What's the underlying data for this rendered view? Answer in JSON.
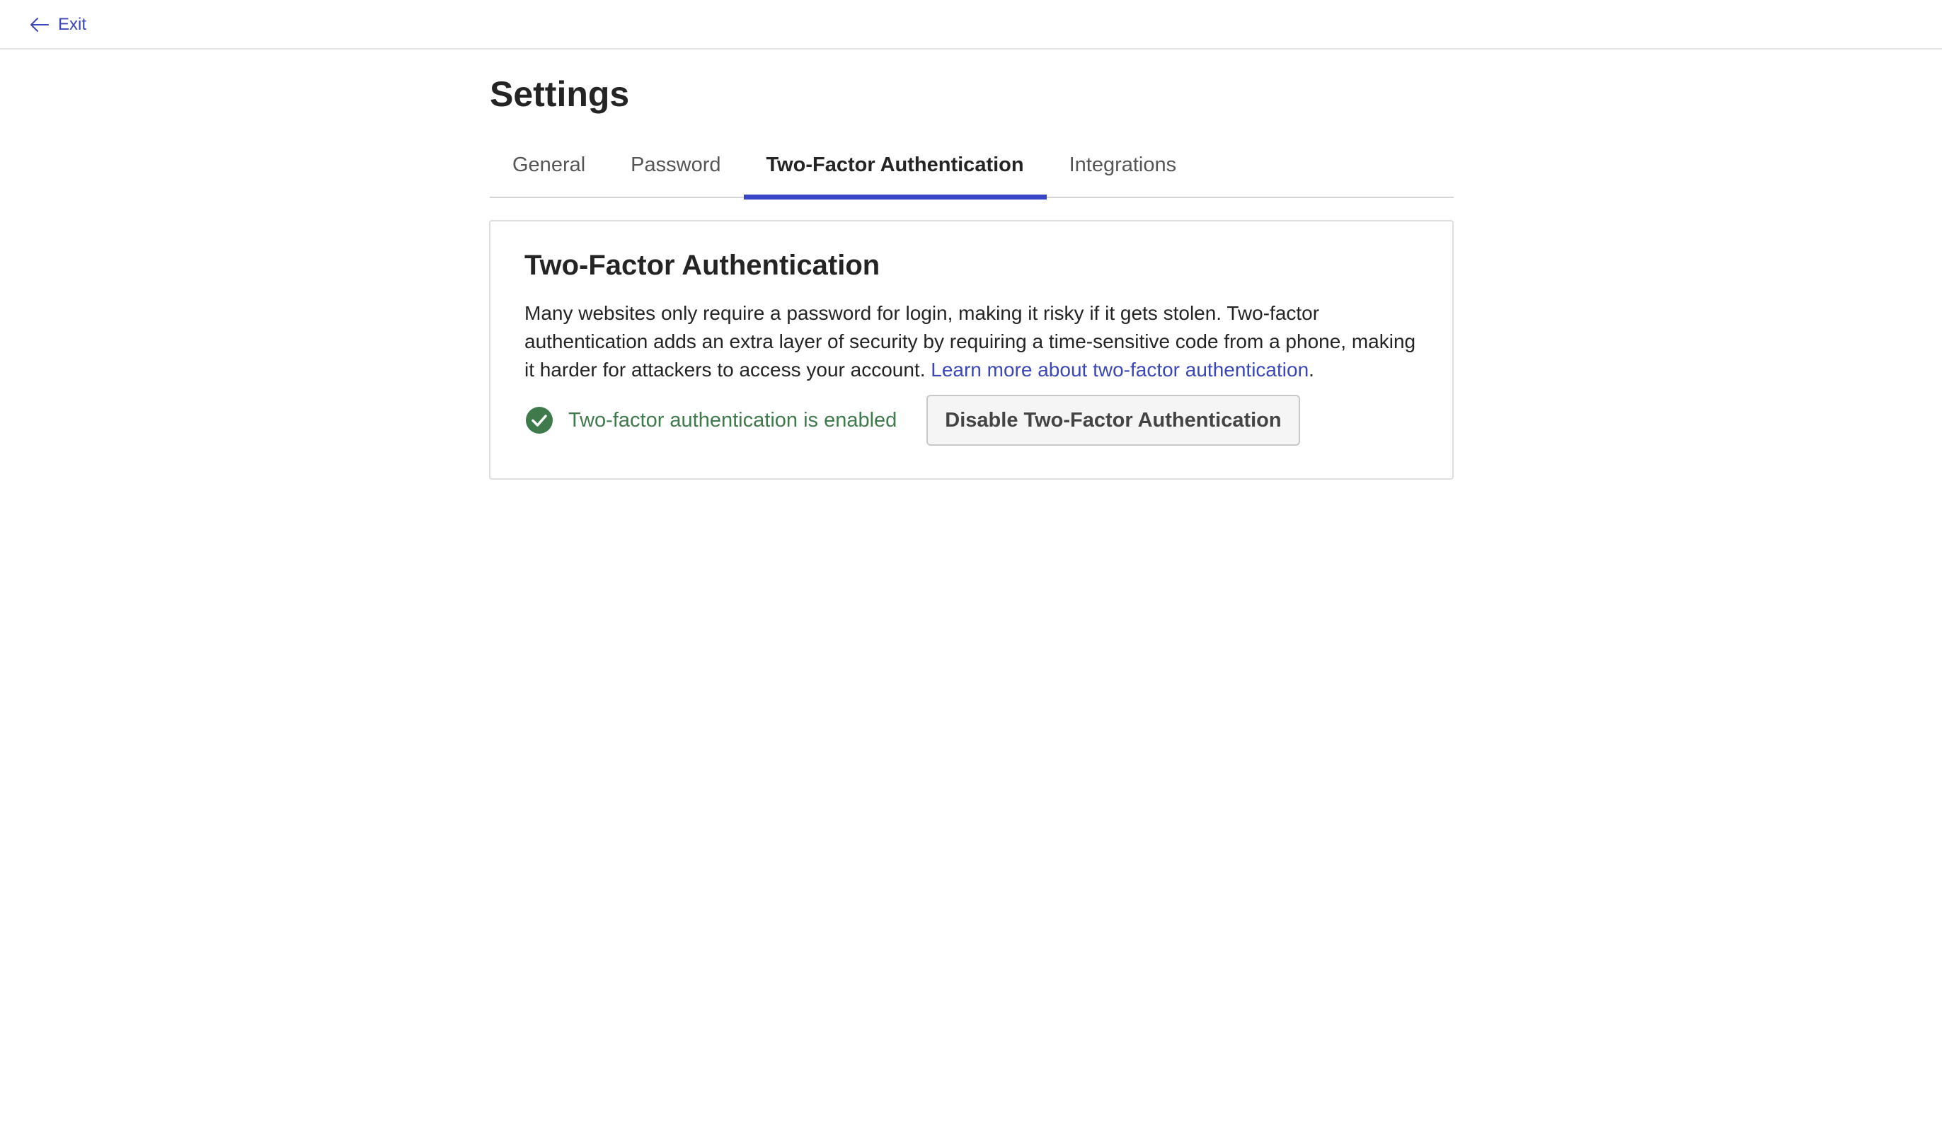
{
  "topbar": {
    "exit_label": "Exit",
    "exit_icon": "arrow-left-icon",
    "link_color": "#3b46b8"
  },
  "page": {
    "title": "Settings"
  },
  "tabs": [
    {
      "label": "General",
      "active": false
    },
    {
      "label": "Password",
      "active": false
    },
    {
      "label": "Two-Factor Authentication",
      "active": true
    },
    {
      "label": "Integrations",
      "active": false
    }
  ],
  "tab_indicator_color": "#3a46c8",
  "card": {
    "title": "Two-Factor Authentication",
    "description": "Many websites only require a password for login, making it risky if it gets stolen. Two-factor authentication adds an extra layer of security by requiring a time-sensitive code from a phone, making it harder for attackers to access your account. ",
    "learn_more_link": "Learn more about two-factor authentication",
    "description_end": ".",
    "status_icon": "check-circle-icon",
    "status_text": "Two-factor authentication is enabled",
    "status_color": "#3f7a4d",
    "disable_button": "Disable Two-Factor Authentication"
  }
}
